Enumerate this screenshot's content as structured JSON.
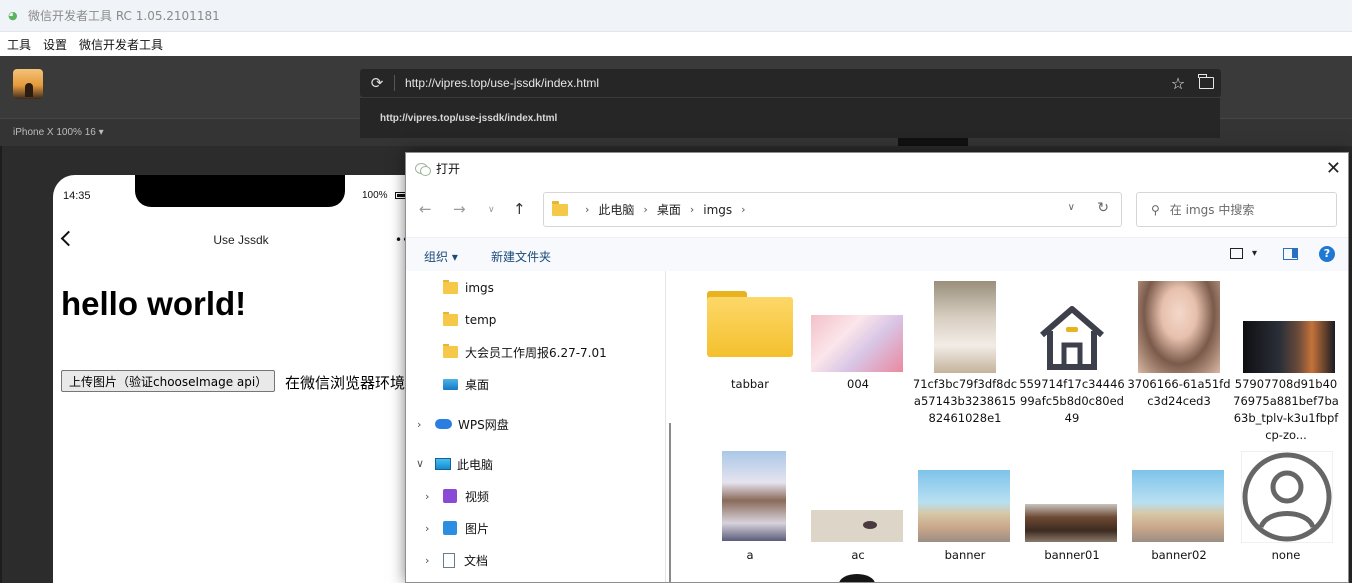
{
  "app": {
    "title": "微信开发者工具 RC 1.05.2101181"
  },
  "menu": [
    "工具",
    "设置",
    "微信开发者工具"
  ],
  "toolbar": {
    "url": "http://vipres.top/use-jssdk/index.html",
    "suggestion": "http://vipres.top/use-jssdk/index.html"
  },
  "device": {
    "label": "iPhone X 100% 16 ▾"
  },
  "phone": {
    "time": "14:35",
    "battery": "100%",
    "nav_title": "Use Jssdk",
    "more": "••",
    "heading": "hello world!",
    "upload_button": "上传图片（验证chooseImage api）",
    "note": "在微信浏览器环境中"
  },
  "dialog": {
    "title": "打开",
    "close": "✕",
    "breadcrumb": [
      "此电脑",
      "桌面",
      "imgs"
    ],
    "search_placeholder": "在 imgs 中搜索",
    "organize": "组织 ▾",
    "new_folder": "新建文件夹",
    "tree": [
      {
        "label": "imgs",
        "icon": "folder-icon"
      },
      {
        "label": "temp",
        "icon": "folder-icon"
      },
      {
        "label": "大会员工作周报6.27-7.01",
        "icon": "folder-icon"
      },
      {
        "label": "桌面",
        "icon": "desktop-icon"
      },
      {
        "label": "WPS网盘",
        "icon": "cloud-icon"
      },
      {
        "label": "此电脑",
        "icon": "pc-icon"
      },
      {
        "label": "视频",
        "icon": "video-icon"
      },
      {
        "label": "图片",
        "icon": "picture-icon"
      },
      {
        "label": "文档",
        "icon": "document-icon"
      }
    ],
    "files": [
      {
        "name": "tabbar"
      },
      {
        "name": "004"
      },
      {
        "name": "71cf3bc79f3df8dca57143b323861582461028e1"
      },
      {
        "name": "559714f17c3444699afc5b8d0c80ed49"
      },
      {
        "name": "3706166-61a51fdc3d24ced3"
      },
      {
        "name": "57907708d91b4076975a881bef7ba63b_tplv-k3u1fbpfcp-zo..."
      },
      {
        "name": "a"
      },
      {
        "name": "ac"
      },
      {
        "name": "banner"
      },
      {
        "name": "banner01"
      },
      {
        "name": "banner02"
      },
      {
        "name": "none"
      }
    ]
  }
}
